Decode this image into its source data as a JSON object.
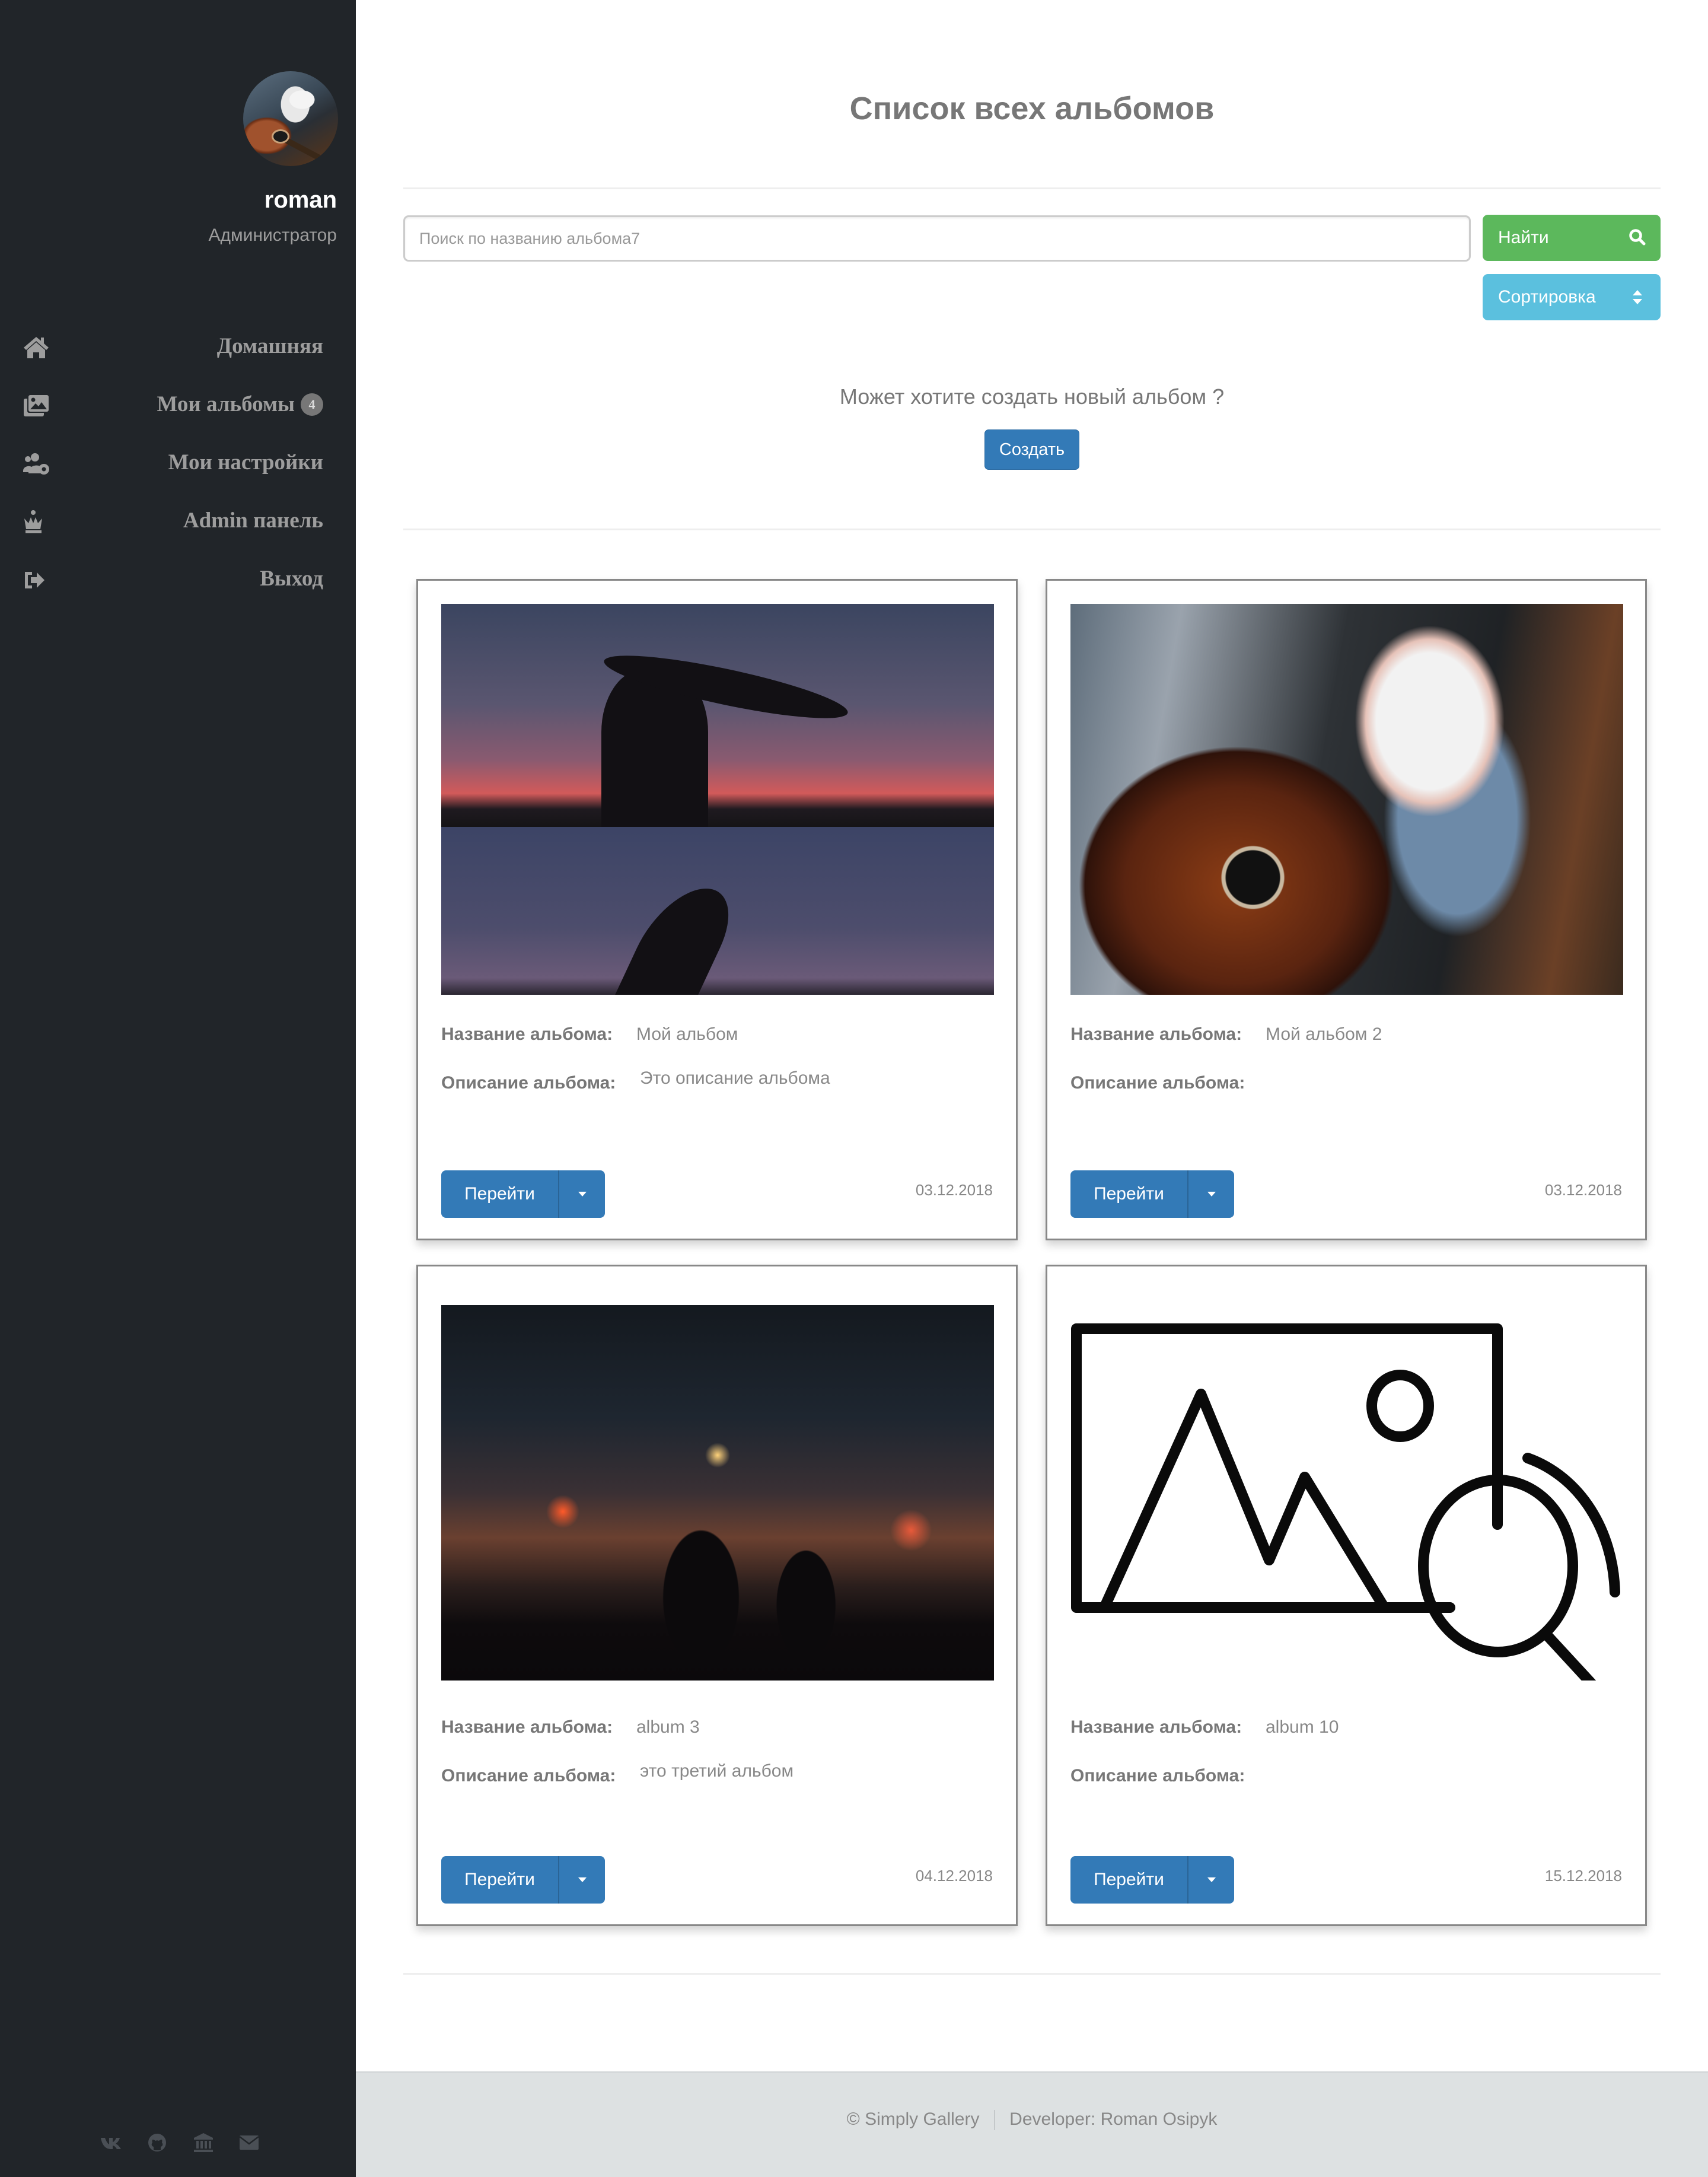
{
  "sidebar": {
    "user": {
      "name": "roman",
      "role": "Администратор"
    },
    "nav": [
      {
        "label": "Домашняя",
        "icon": "home-icon"
      },
      {
        "label": "Мои альбомы",
        "icon": "images-icon",
        "badge": "4"
      },
      {
        "label": "Мои настройки",
        "icon": "users-cog-icon"
      },
      {
        "label": "Admin панель",
        "icon": "chess-queen-icon"
      },
      {
        "label": "Выход",
        "icon": "sign-out-icon"
      }
    ],
    "social": [
      "vk-icon",
      "github-icon",
      "university-icon",
      "envelope-icon"
    ]
  },
  "main": {
    "title": "Список всех альбомов",
    "search": {
      "value": "",
      "placeholder": "Поиск по названию альбома7"
    },
    "find_label": "Найти",
    "sort_label": "Сортировка",
    "create_prompt": "Может хотите создать новый альбом ?",
    "create_label": "Создать",
    "colors": {
      "primary": "#337ab7",
      "success": "#5cb85c",
      "info": "#5bc0de",
      "sidebar": "#212529"
    }
  },
  "cards": {
    "name_label": "Название альбома:",
    "desc_label": "Описание альбома:",
    "open_label": "Перейти",
    "items": [
      {
        "name": "Мой альбом",
        "description": "Это описание альбома",
        "date": "03.12.2018",
        "image": "silhouette-sunset-photo"
      },
      {
        "name": "Мой альбом 2",
        "description": "",
        "date": "03.12.2018",
        "image": "guitar-shark-photo"
      },
      {
        "name": "album 3",
        "description": "это третий альбом",
        "date": "04.12.2018",
        "image": "night-city-couple-photo"
      },
      {
        "name": "album 10",
        "description": "",
        "date": "15.12.2018",
        "image": "no-image-placeholder"
      }
    ]
  },
  "footer": {
    "copyright": "© Simply Gallery",
    "developer": "Developer: Roman Osipyk"
  }
}
